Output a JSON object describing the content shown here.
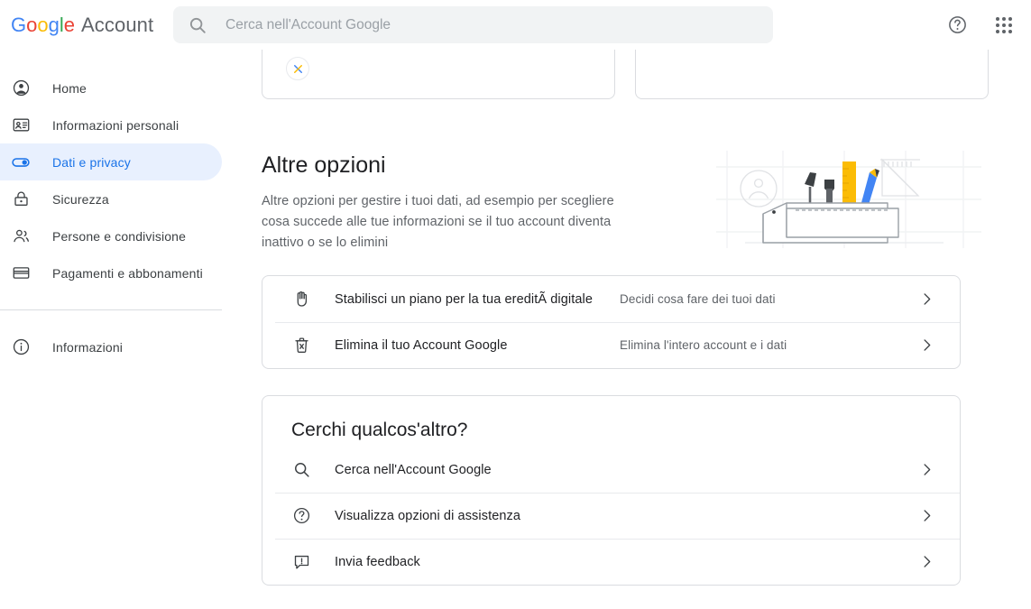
{
  "header": {
    "brand_google": "Google",
    "brand_product": "Account",
    "search_placeholder": "Cerca nell'Account Google",
    "search_value": "",
    "search_icon": "search-icon",
    "help_icon": "help-circle-icon",
    "apps_icon": "google-apps-grid-icon"
  },
  "sidebar": {
    "items": [
      {
        "label": "Home",
        "icon": "account-circle-icon",
        "active": false
      },
      {
        "label": "Informazioni personali",
        "icon": "id-card-icon",
        "active": false
      },
      {
        "label": "Dati e privacy",
        "icon": "toggle-switch-icon",
        "active": true
      },
      {
        "label": "Sicurezza",
        "icon": "lock-icon",
        "active": false
      },
      {
        "label": "Persone e condivisione",
        "icon": "people-icon",
        "active": false
      },
      {
        "label": "Pagamenti e abbonamenti",
        "icon": "credit-card-icon",
        "active": false
      }
    ],
    "footer_items": [
      {
        "label": "Informazioni",
        "icon": "info-circle-icon"
      }
    ]
  },
  "main": {
    "section": {
      "title": "Altre opzioni",
      "description": "Altre opzioni per gestire i tuoi dati, ad esempio per scegliere cosa succede alle tue informazioni se il tuo account diventa inattivo o se lo elimini",
      "illustration": "toolbox-with-tools-illustration"
    },
    "options_rows": [
      {
        "label": "Stabilisci un piano per la tua ereditÃ  digitale",
        "description": "Decidi cosa fare dei tuoi dati",
        "icon": "back-hand-icon",
        "chevron": "chevron-right-icon"
      },
      {
        "label": "Elimina il tuo Account Google",
        "description": "Elimina l'intero account e i dati",
        "icon": "delete-forever-icon",
        "chevron": "chevron-right-icon"
      }
    ],
    "more_card": {
      "title": "Cerchi qualcos'altro?",
      "rows": [
        {
          "label": "Cerca nell'Account Google",
          "icon": "search-icon",
          "chevron": "chevron-right-icon"
        },
        {
          "label": "Visualizza opzioni di assistenza",
          "icon": "help-circle-icon",
          "chevron": "chevron-right-icon"
        },
        {
          "label": "Invia feedback",
          "icon": "feedback-icon",
          "chevron": "chevron-right-icon"
        }
      ]
    }
  },
  "colors": {
    "accent_blue": "#1a73e8",
    "accent_blue_bg": "#e8f0fe",
    "text_primary": "#202124",
    "text_secondary": "#5f6368",
    "border": "#dadce0",
    "google_blue": "#4285f4",
    "google_red": "#ea4335",
    "google_yellow": "#fbbc05",
    "google_green": "#34a853"
  }
}
